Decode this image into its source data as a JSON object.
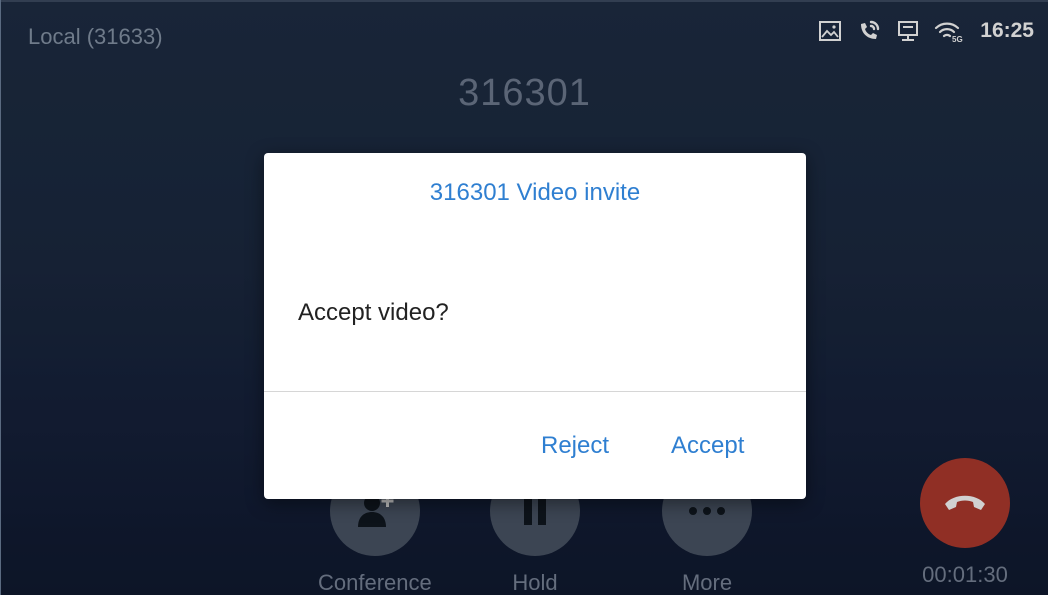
{
  "status_bar": {
    "local_label": "Local (31633)",
    "time": "16:25",
    "icons": [
      "gallery-icon",
      "call-active-icon",
      "network-icon",
      "wifi-5g-icon"
    ]
  },
  "call": {
    "number": "316301",
    "duration": "00:01:30"
  },
  "controls": [
    {
      "label": "Conference",
      "icon": "add-contact-icon"
    },
    {
      "label": "Hold",
      "icon": "pause-icon"
    },
    {
      "label": "More",
      "icon": "more-dots-icon"
    }
  ],
  "dialog": {
    "title": "316301 Video invite",
    "message": "Accept video?",
    "reject_label": "Reject",
    "accept_label": "Accept"
  },
  "colors": {
    "accent_blue": "#2f7fd1",
    "hangup_red": "#b03a2e",
    "background": "#1b2940"
  }
}
